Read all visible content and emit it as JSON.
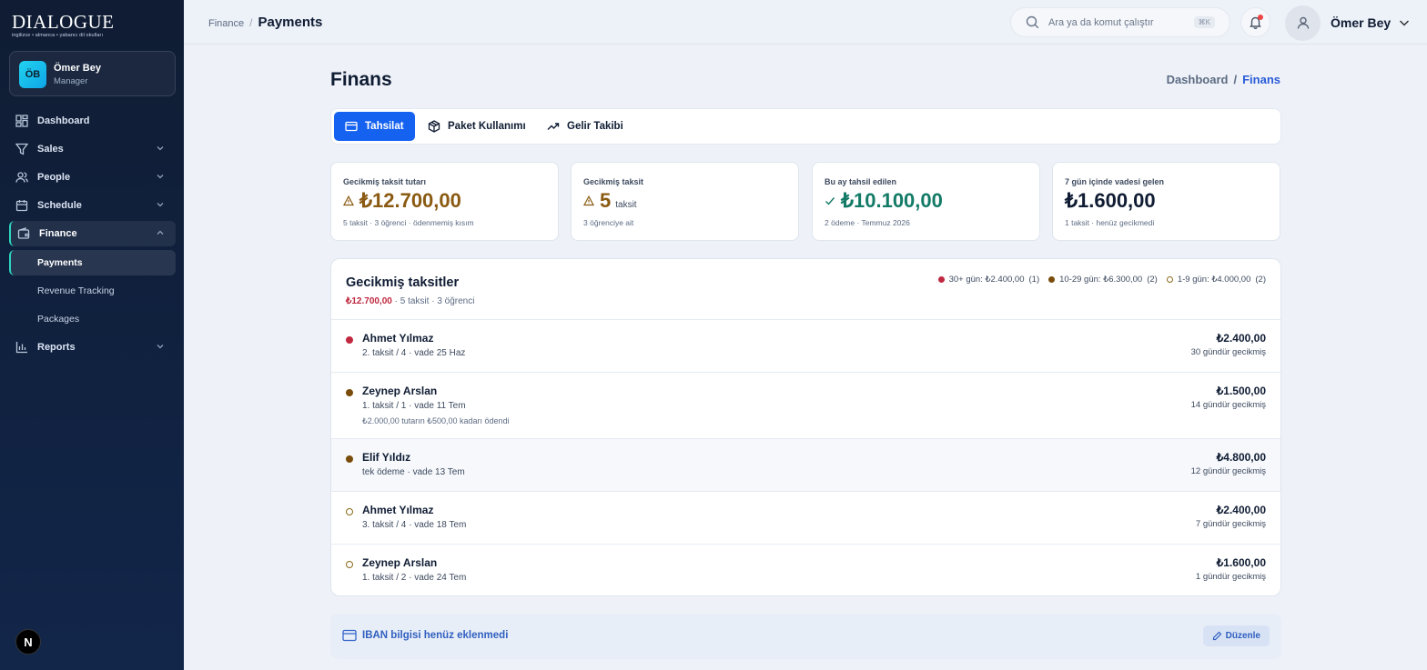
{
  "brand": {
    "title": "DIALOGUE",
    "subtitle": "ingilizce • almanca • yabancı dil okulları"
  },
  "user_card": {
    "initials": "ÖB",
    "name": "Ömer Bey",
    "role": "Manager"
  },
  "sidebar": {
    "items": [
      {
        "label": "Dashboard"
      },
      {
        "label": "Sales"
      },
      {
        "label": "People"
      },
      {
        "label": "Schedule"
      },
      {
        "label": "Finance"
      },
      {
        "label": "Payments"
      },
      {
        "label": "Revenue Tracking"
      },
      {
        "label": "Packages"
      },
      {
        "label": "Reports"
      }
    ],
    "badge": "N"
  },
  "topbar": {
    "breadcrumb_parent": "Finance",
    "breadcrumb_sep": "/",
    "breadcrumb_current": "Payments",
    "search_placeholder": "Ara ya da komut çalıştır",
    "shortcut": "⌘K",
    "user_name": "Ömer Bey"
  },
  "page": {
    "title": "Finans",
    "crumb_parent": "Dashboard",
    "crumb_sep": "/",
    "crumb_current": "Finans"
  },
  "tabs": [
    {
      "label": "Tahsilat",
      "active": true
    },
    {
      "label": "Paket Kullanımı",
      "active": false
    },
    {
      "label": "Gelir Takibi",
      "active": false
    }
  ],
  "kpis": [
    {
      "label": "Gecikmiş taksit tutarı",
      "value": "₺12.700,00",
      "unit": "",
      "sub": "5 taksit · 3 öğrenci · ödenmemiş kısım",
      "color": "#8a5a12"
    },
    {
      "label": "Gecikmiş taksit",
      "value": "5",
      "unit": "taksit",
      "sub": "3 öğrenciye ait",
      "color": "#8a5a12"
    },
    {
      "label": "Bu ay tahsil edilen",
      "value": "₺10.100,00",
      "unit": "",
      "sub": "2 ödeme · Temmuz 2026",
      "color": "#127a66"
    },
    {
      "label": "7 gün içinde vadesi gelen",
      "value": "₺1.600,00",
      "unit": "",
      "sub": "1 taksit · henüz gecikmedi",
      "color": "#0f1c33"
    }
  ],
  "overdue": {
    "title": "Gecikmiş taksitler",
    "total": "₺12.700,00",
    "summary": " · 5 taksit · 3 öğrenci",
    "legend": [
      {
        "label": "30+ gün: ₺2.400,00",
        "count": "(1)",
        "color": "#c0283f",
        "style": "filled"
      },
      {
        "label": "10-29 gün: ₺6.300,00",
        "count": "(2)",
        "color": "#7a4c0c",
        "style": "filled"
      },
      {
        "label": "1-9 gün: ₺4.000,00",
        "count": "(2)",
        "color": "#8a6a1c",
        "style": "hollow"
      }
    ],
    "rows": [
      {
        "name": "Ahmet Yılmaz",
        "detail": "2. taksit / 4 · vade 25 Haz",
        "note": "",
        "amount": "₺2.400,00",
        "late": "30 gündür gecikmiş",
        "color": "#c0283f",
        "style": "filled"
      },
      {
        "name": "Zeynep Arslan",
        "detail": "1. taksit / 1 · vade 11 Tem",
        "note": "₺2.000,00 tutarın ₺500,00 kadarı ödendi",
        "amount": "₺1.500,00",
        "late": "14 gündür gecikmiş",
        "color": "#7a4c0c",
        "style": "filled"
      },
      {
        "name": "Elif Yıldız",
        "detail": "tek ödeme · vade 13 Tem",
        "note": "",
        "amount": "₺4.800,00",
        "late": "12 gündür gecikmiş",
        "color": "#7a4c0c",
        "style": "filled"
      },
      {
        "name": "Ahmet Yılmaz",
        "detail": "3. taksit / 4 · vade 18 Tem",
        "note": "",
        "amount": "₺2.400,00",
        "late": "7 gündür gecikmiş",
        "color": "#8a6a1c",
        "style": "hollow"
      },
      {
        "name": "Zeynep Arslan",
        "detail": "1. taksit / 2 · vade 24 Tem",
        "note": "",
        "amount": "₺1.600,00",
        "late": "1 gündür gecikmiş",
        "color": "#8a6a1c",
        "style": "hollow"
      }
    ]
  },
  "iban": {
    "text": "IBAN bilgisi henüz eklenmedi",
    "edit_label": "Düzenle"
  }
}
